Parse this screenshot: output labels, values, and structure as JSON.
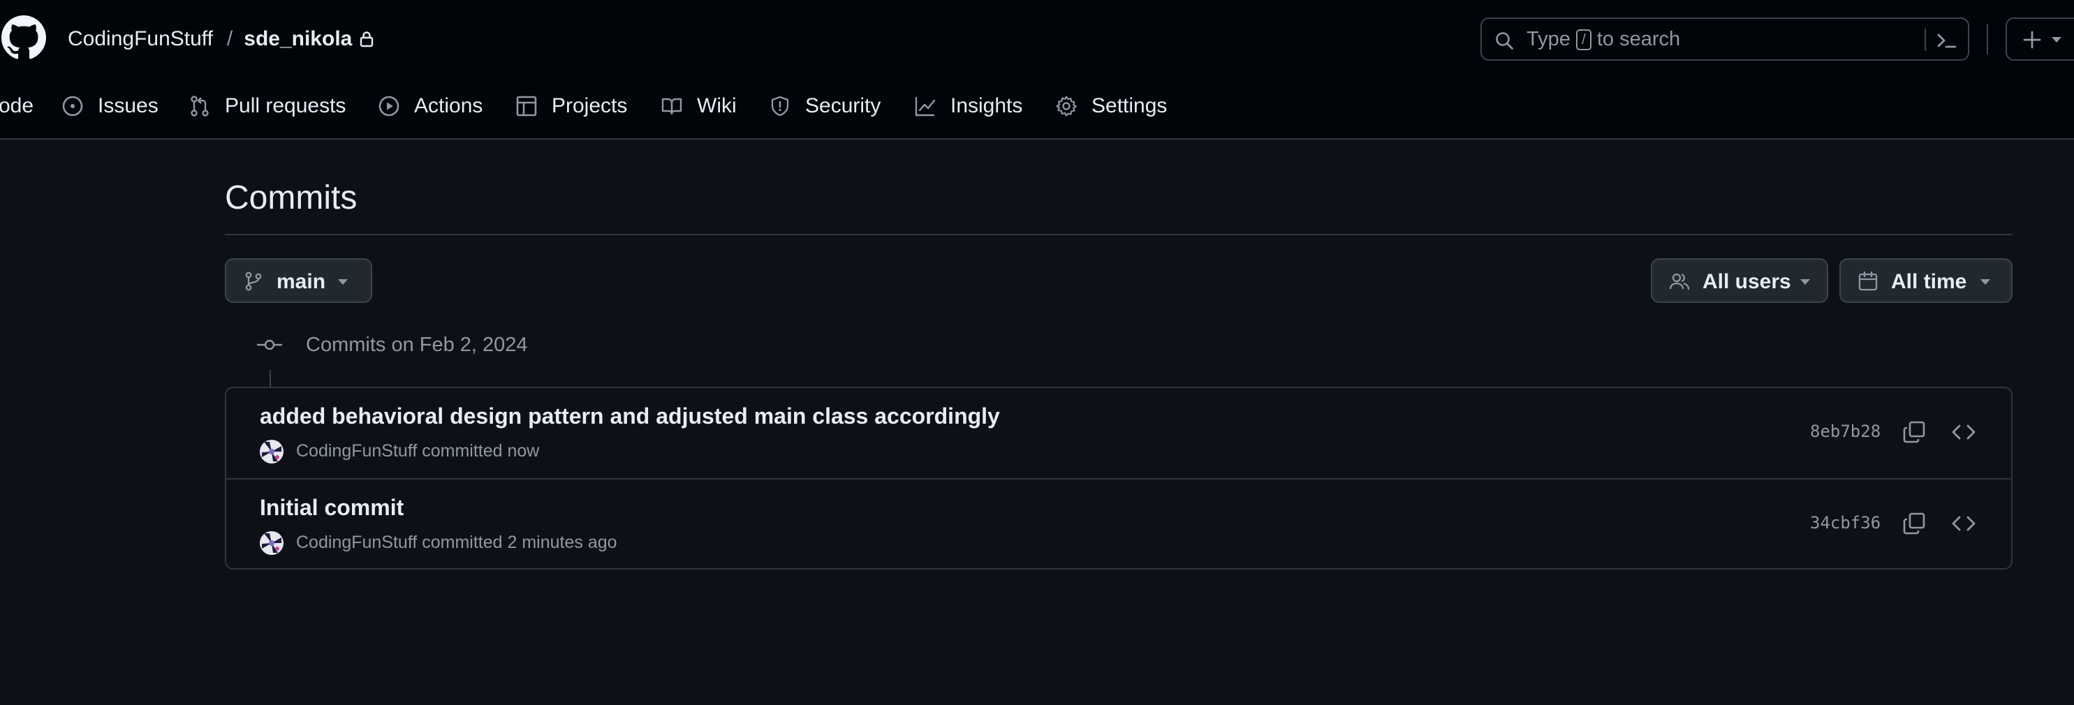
{
  "header": {
    "owner": "CodingFunStuff",
    "separator": "/",
    "repo": "sde_nikola",
    "search": {
      "prefix": "Type",
      "key": "/",
      "suffix": "to search"
    }
  },
  "nav": {
    "items": [
      {
        "label": "ode",
        "icon": "code-icon"
      },
      {
        "label": "Issues",
        "icon": "issue-icon"
      },
      {
        "label": "Pull requests",
        "icon": "pull-request-icon"
      },
      {
        "label": "Actions",
        "icon": "play-icon"
      },
      {
        "label": "Projects",
        "icon": "table-icon"
      },
      {
        "label": "Wiki",
        "icon": "book-icon"
      },
      {
        "label": "Security",
        "icon": "shield-icon"
      },
      {
        "label": "Insights",
        "icon": "graph-icon"
      },
      {
        "label": "Settings",
        "icon": "gear-icon"
      }
    ]
  },
  "page": {
    "title": "Commits",
    "branch": "main",
    "users_filter": "All users",
    "time_filter": "All time"
  },
  "groups": [
    {
      "label": "Commits on Feb 2, 2024",
      "commits": [
        {
          "title": "added behavioral design pattern and adjusted main class accordingly",
          "author": "CodingFunStuff",
          "meta": "committed now",
          "sha": "8eb7b28"
        },
        {
          "title": "Initial commit",
          "author": "CodingFunStuff",
          "meta": "committed 2 minutes ago",
          "sha": "34cbf36"
        }
      ]
    }
  ],
  "colors": {
    "header_bg": "#010409",
    "page_bg": "#0d1117",
    "border": "#30363d",
    "text": "#e6edf3",
    "muted": "#9198a1",
    "button_bg": "#212830"
  }
}
